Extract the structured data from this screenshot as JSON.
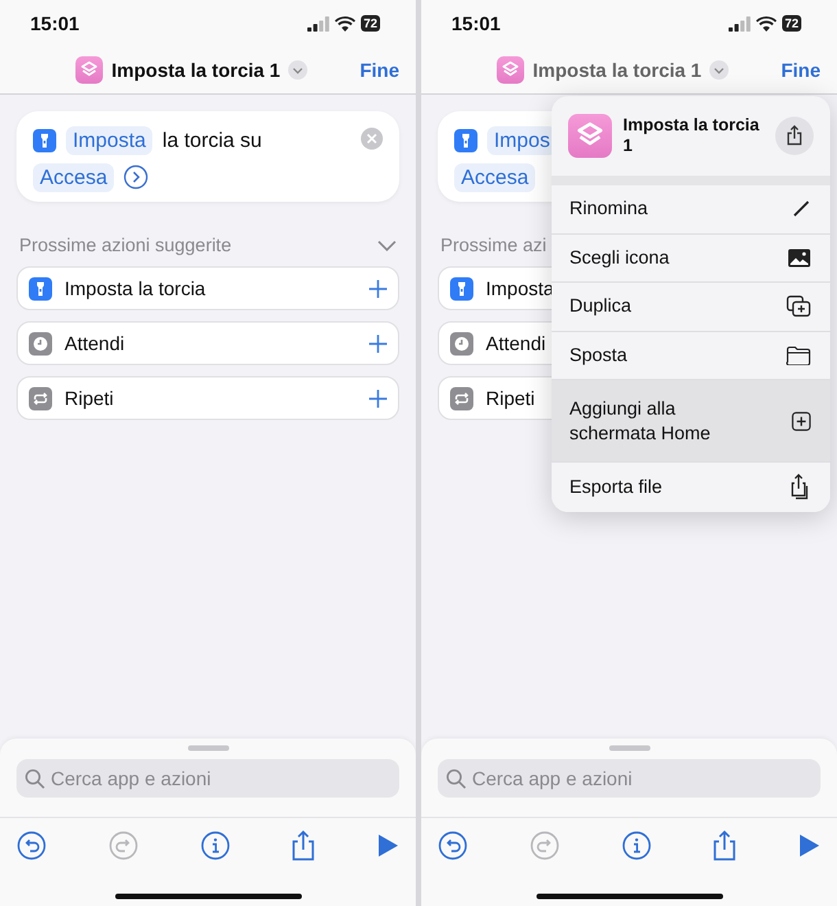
{
  "screens": [
    {
      "status_bar": {
        "time": "15:01",
        "battery": "72"
      },
      "header": {
        "title": "Imposta la torcia 1",
        "done": "Fine",
        "dimmed": false
      },
      "action": {
        "parameter": "Imposta",
        "text": "la torcia su",
        "value": "Accesa"
      },
      "suggestions": {
        "title": "Prossime azioni suggerite",
        "items": [
          {
            "label": "Imposta la torcia",
            "kind": "flashlight"
          },
          {
            "label": "Attendi",
            "kind": "clock"
          },
          {
            "label": "Ripeti",
            "kind": "repeat"
          }
        ]
      },
      "search": {
        "placeholder": "Cerca app e azioni"
      },
      "toolbar": [
        {
          "kind": "undo",
          "disabled": false
        },
        {
          "kind": "redo",
          "disabled": true
        },
        {
          "kind": "info",
          "disabled": false
        },
        {
          "kind": "share",
          "disabled": false
        },
        {
          "kind": "play",
          "disabled": false
        }
      ]
    },
    {
      "status_bar": {
        "time": "15:01",
        "battery": "72"
      },
      "header": {
        "title": "Imposta la torcia 1",
        "done": "Fine",
        "dimmed": true
      },
      "action": {
        "parameter": "Impos",
        "value": "Accesa"
      },
      "suggestions": {
        "title": "Prossime azi",
        "items": [
          {
            "label": "Imposta",
            "kind": "flashlight"
          },
          {
            "label": "Attendi",
            "kind": "clock"
          },
          {
            "label": "Ripeti",
            "kind": "repeat"
          }
        ]
      },
      "search": {
        "placeholder": "Cerca app e azioni"
      },
      "toolbar": [
        {
          "kind": "undo",
          "disabled": false
        },
        {
          "kind": "redo",
          "disabled": true
        },
        {
          "kind": "info",
          "disabled": false
        },
        {
          "kind": "share",
          "disabled": false
        },
        {
          "kind": "play",
          "disabled": false
        }
      ],
      "menu": {
        "title": "Imposta la torcia 1",
        "items": [
          {
            "label": "Rinomina",
            "kind": "pencil",
            "selected": false
          },
          {
            "label": "Scegli icona",
            "kind": "image",
            "selected": false
          },
          {
            "label": "Duplica",
            "kind": "duplicate",
            "selected": false
          },
          {
            "label": "Sposta",
            "kind": "folder",
            "selected": false
          },
          {
            "label": "Aggiungi alla schermata Home",
            "kind": "add",
            "selected": true
          },
          {
            "label": "Esporta file",
            "kind": "export",
            "selected": false
          }
        ]
      }
    }
  ]
}
